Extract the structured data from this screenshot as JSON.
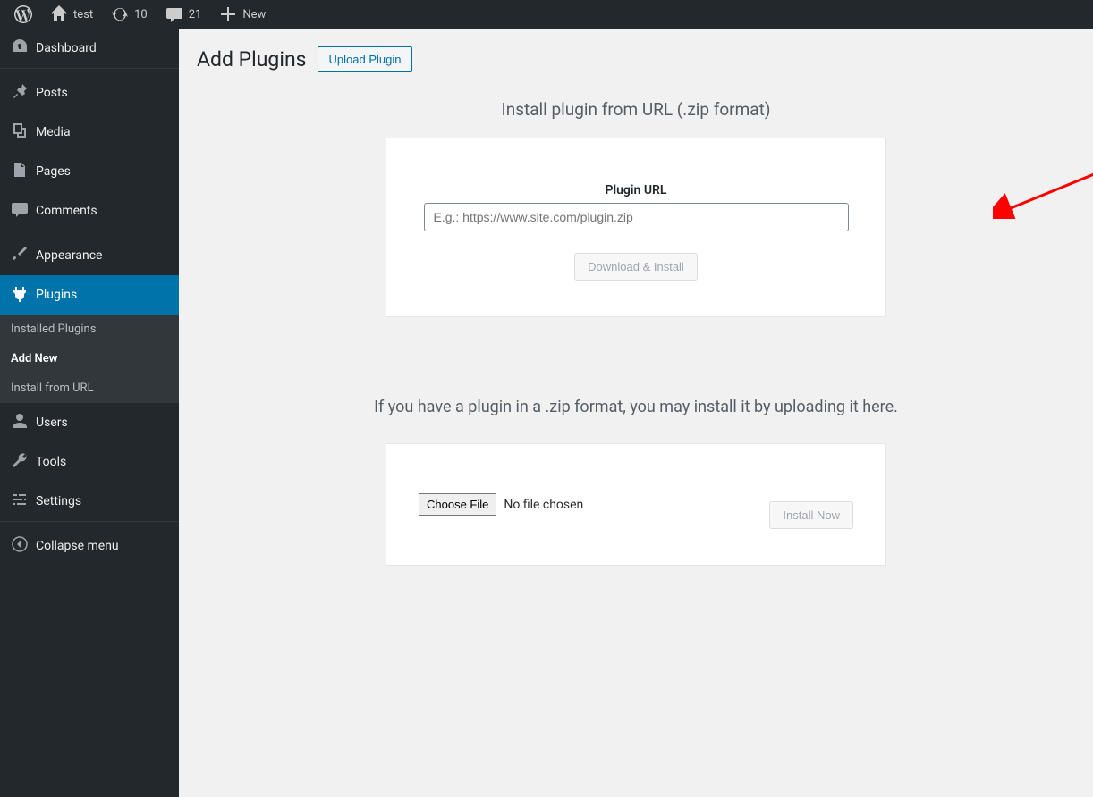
{
  "adminbar": {
    "site_name": "test",
    "updates_count": "10",
    "comments_count": "21",
    "new_label": "New"
  },
  "sidebar": {
    "dashboard": "Dashboard",
    "posts": "Posts",
    "media": "Media",
    "pages": "Pages",
    "comments": "Comments",
    "appearance": "Appearance",
    "plugins": "Plugins",
    "users": "Users",
    "tools": "Tools",
    "settings": "Settings",
    "collapse": "Collapse menu",
    "submenu": {
      "installed": "Installed Plugins",
      "add_new": "Add New",
      "install_url": "Install from URL"
    }
  },
  "main": {
    "title": "Add Plugins",
    "upload_button": "Upload Plugin",
    "url_install": {
      "heading": "Install plugin from URL (.zip format)",
      "label": "Plugin URL",
      "placeholder": "E.g.: https://www.site.com/plugin.zip",
      "button": "Download & Install"
    },
    "zip_upload": {
      "help": "If you have a plugin in a .zip format, you may install it by uploading it here.",
      "choose_file": "Choose File",
      "no_file": "No file chosen",
      "install_now": "Install Now"
    }
  }
}
